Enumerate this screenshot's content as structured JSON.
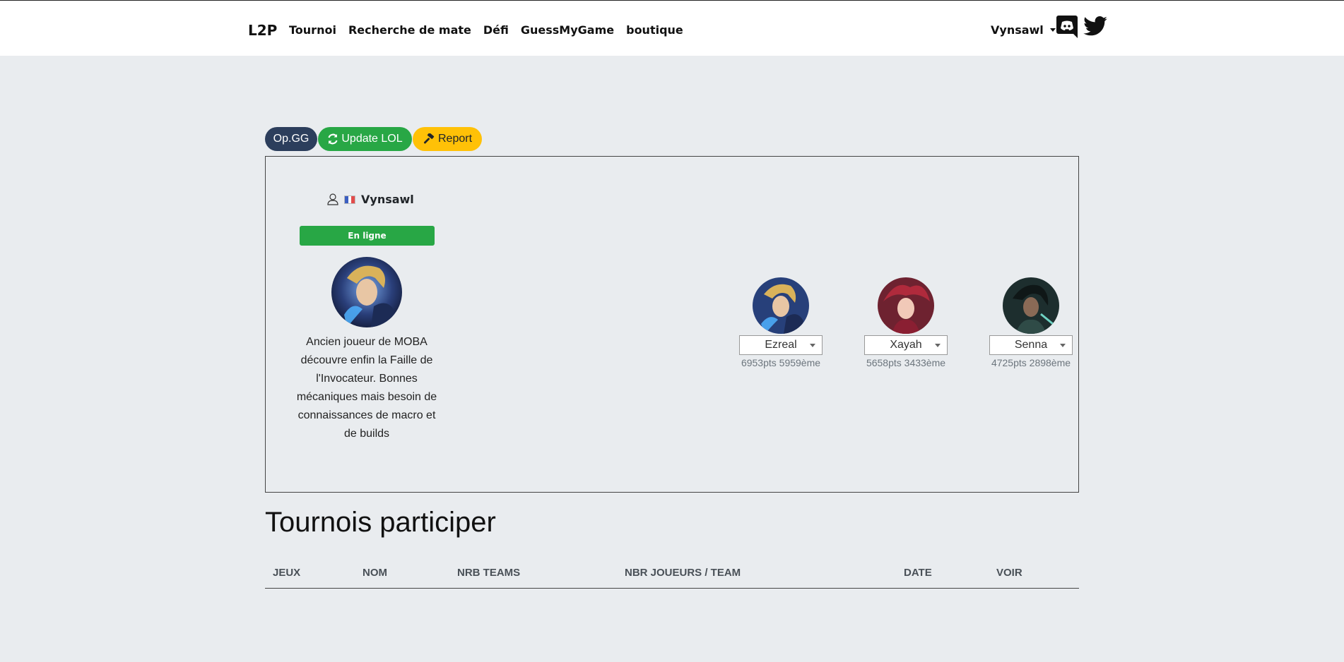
{
  "navbar": {
    "brand": "L2P",
    "links": [
      "Tournoi",
      "Recherche de mate",
      "Défi",
      "GuessMyGame",
      "boutique"
    ],
    "user": "Vynsawl"
  },
  "actions": {
    "opgg": "Op.GG",
    "update": "Update LOL",
    "report": "Report"
  },
  "profile": {
    "name": "Vynsawl",
    "status": "En ligne",
    "bio": "Ancien joueur de MOBA découvre enfin la Faille de l'Invocateur. Bonnes mécaniques mais besoin de connaissances de macro et de builds"
  },
  "champions": [
    {
      "name": "Ezreal",
      "stats": "6953pts 5959ème"
    },
    {
      "name": "Xayah",
      "stats": "5658pts 3433ème"
    },
    {
      "name": "Senna",
      "stats": "4725pts 2898ème"
    }
  ],
  "tournaments": {
    "title": "Tournois participer",
    "columns": [
      "JEUX",
      "NOM",
      "NRB TEAMS",
      "NBR JOUEURS / TEAM",
      "DATE",
      "VOIR"
    ]
  },
  "colors": {
    "success": "#28a745",
    "warning": "#ffc107",
    "dark_blue": "#2c3e5c",
    "background": "#e9ecef"
  }
}
